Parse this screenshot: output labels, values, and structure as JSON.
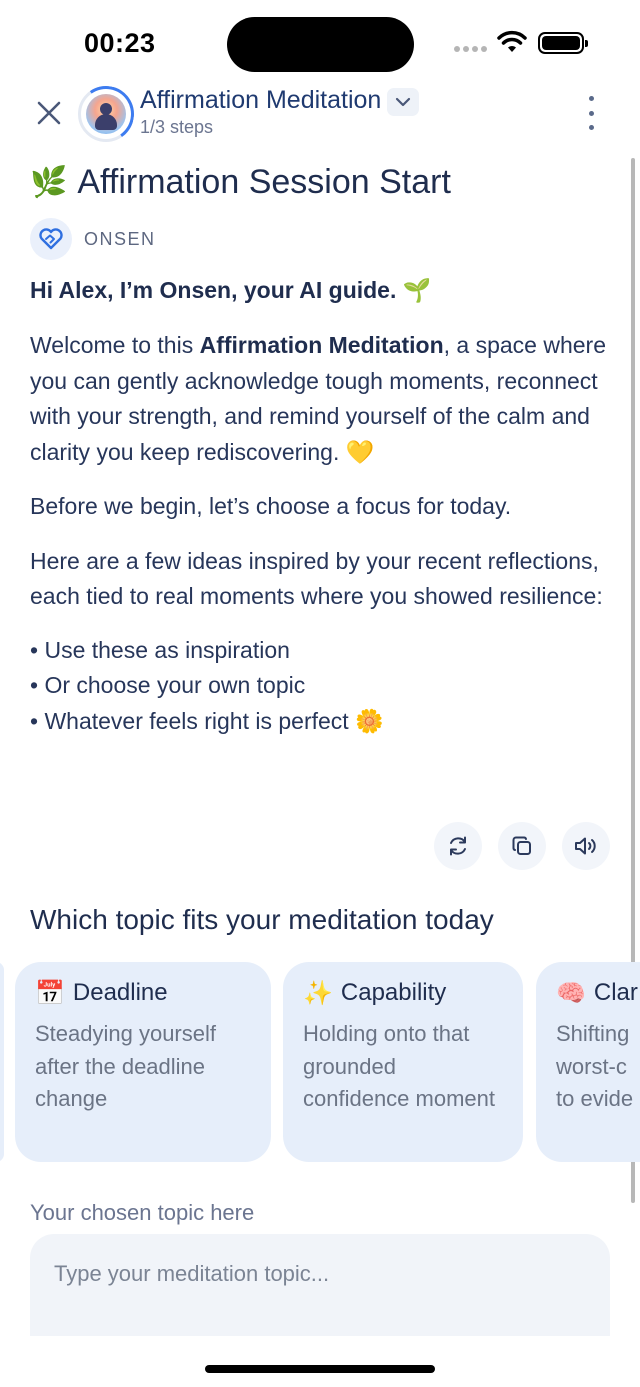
{
  "status_bar": {
    "time": "00:23"
  },
  "header": {
    "title": "Affirmation Meditation",
    "steps": "1/3 steps"
  },
  "session": {
    "emoji": "🌿",
    "title": "Affirmation Session Start"
  },
  "author": {
    "name": "ONSEN"
  },
  "message": {
    "greeting": "Hi Alex, I’m Onsen, your AI guide. 🌱",
    "intro_before": "Welcome to this ",
    "intro_bold": "Affirmation Meditation",
    "intro_after": ", a space where you can gently acknowledge tough moments, reconnect with your strength, and remind yourself of the calm and clarity you keep rediscovering. 💛",
    "focus": "Before we begin, let’s choose a focus for today.",
    "ideas": "Here are a few ideas inspired by your recent reflections, each tied to real moments where you showed resilience:",
    "bullets": [
      "Use these as inspiration",
      "Or choose your own topic",
      "Whatever feels right is perfect 🌼"
    ]
  },
  "topics": {
    "heading": "Which topic fits your meditation today",
    "cards": [
      {
        "emoji": "📅",
        "title": "Deadline",
        "description": "Steadying yourself after the deadline change"
      },
      {
        "emoji": "✨",
        "title": "Capability",
        "description": "Holding onto that grounded confidence moment"
      },
      {
        "emoji": "🧠",
        "title": "Clar",
        "description": "Shifting worst-c to evide"
      }
    ]
  },
  "chosen_topic": {
    "label": "Your chosen topic here",
    "placeholder": "Type your meditation topic..."
  },
  "colors": {
    "accent": "#3d7cf0",
    "title_text": "#1f2d4e",
    "card_bg": "#e6eefa",
    "input_bg": "#f1f4f9"
  },
  "icons": [
    "close-icon",
    "chevron-down-icon",
    "more-vertical-icon",
    "onsen-logo-icon",
    "refresh-icon",
    "copy-icon",
    "speaker-icon"
  ]
}
